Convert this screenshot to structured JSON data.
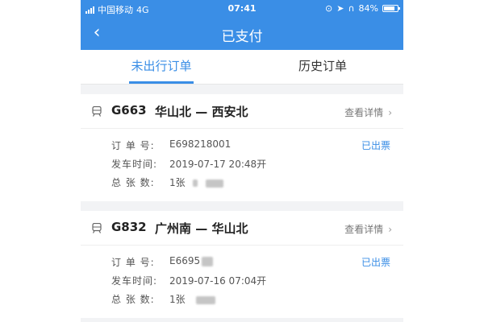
{
  "status_bar": {
    "carrier": "中国移动",
    "network": "4G",
    "time": "07:41",
    "battery": "84%",
    "battery_level": 0.84
  },
  "nav": {
    "title": "已支付"
  },
  "tabs": [
    {
      "label": "未出行订单",
      "active": true
    },
    {
      "label": "历史订单",
      "active": false
    }
  ],
  "orders": [
    {
      "train_no": "G663",
      "route": "华山北 — 西安北",
      "detail_label": "查看详情",
      "status": "已出票",
      "order_no_label": "订 单 号:",
      "order_no": "E698218001",
      "depart_label": "发车时间:",
      "depart_time": "2019-07-17   20:48开",
      "count_label": "总 张 数:",
      "count": "1张"
    },
    {
      "train_no": "G832",
      "route": "广州南 — 华山北",
      "detail_label": "查看详情",
      "status": "已出票",
      "order_no_label": "订 单 号:",
      "order_no": "E6695",
      "depart_label": "发车时间:",
      "depart_time": "2019-07-16   07:04开",
      "count_label": "总 张 数:",
      "count": "1张"
    }
  ],
  "colors": {
    "primary": "#3a8ee6",
    "background": "#f2f3f5"
  },
  "icons": {
    "back": "chevron-left-icon",
    "train": "train-icon",
    "detail": "chevron-right-icon"
  }
}
